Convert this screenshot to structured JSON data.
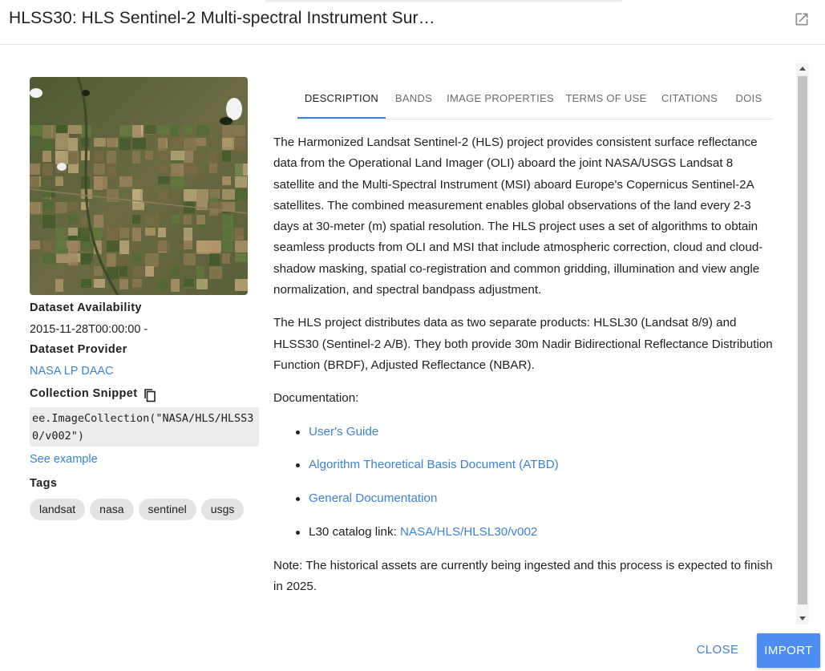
{
  "header": {
    "title": "HLSS30: HLS Sentinel-2 Multi-spectral Instrument Sur…",
    "open_icon": "open-in-new-icon"
  },
  "sidebar": {
    "availability_label": "Dataset Availability",
    "availability_value": "2015-11-28T00:00:00 -",
    "provider_label": "Dataset Provider",
    "provider_value": "NASA LP DAAC",
    "snippet_label": "Collection Snippet",
    "copy_icon": "copy-icon",
    "snippet_code": "ee.ImageCollection(\"NASA/HLS/HLSS30/v002\")",
    "see_example": "See example",
    "tags_label": "Tags",
    "tags": [
      "landsat",
      "nasa",
      "sentinel",
      "usgs"
    ]
  },
  "tabs": [
    {
      "label": "DESCRIPTION",
      "active": true
    },
    {
      "label": "BANDS",
      "active": false
    },
    {
      "label": "IMAGE PROPERTIES",
      "active": false
    },
    {
      "label": "TERMS OF USE",
      "active": false
    },
    {
      "label": "CITATIONS",
      "active": false
    },
    {
      "label": "DOIS",
      "active": false
    }
  ],
  "content": {
    "paragraph1": "The Harmonized Landsat Sentinel-2 (HLS) project provides consistent surface reflectance data from the Operational Land Imager (OLI) aboard the joint NASA/USGS Landsat 8 satellite and the Multi-Spectral Instrument (MSI) aboard Europe's Copernicus Sentinel-2A satellites. The combined measurement enables global observations of the land every 2-3 days at 30-meter (m) spatial resolution. The HLS project uses a set of algorithms to obtain seamless products from OLI and MSI that include atmospheric correction, cloud and cloud-shadow masking, spatial co-registration and common gridding, illumination and view angle normalization, and spectral bandpass adjustment.",
    "paragraph2": "The HLS project distributes data as two separate products: HLSL30 (Landsat 8/9) and HLSS30 (Sentinel-2 A/B). They both provide 30m Nadir Bidirectional Reflectance Distribution Function (BRDF), Adjusted Reflectance (NBAR).",
    "doc_label": "Documentation:",
    "doc_links": [
      "User's Guide",
      "Algorithm Theoretical Basis Document (ATBD)",
      "General Documentation"
    ],
    "catalog_prefix": "L30 catalog link: ",
    "catalog_link": "NASA/HLS/HLSL30/v002",
    "note": "Note: The historical assets are currently being ingested and this process is expected to finish in 2025."
  },
  "footer": {
    "close_label": "CLOSE",
    "import_label": "IMPORT"
  },
  "colors": {
    "accent": "#3b82d6",
    "primary_button": "#4c8ef0"
  }
}
